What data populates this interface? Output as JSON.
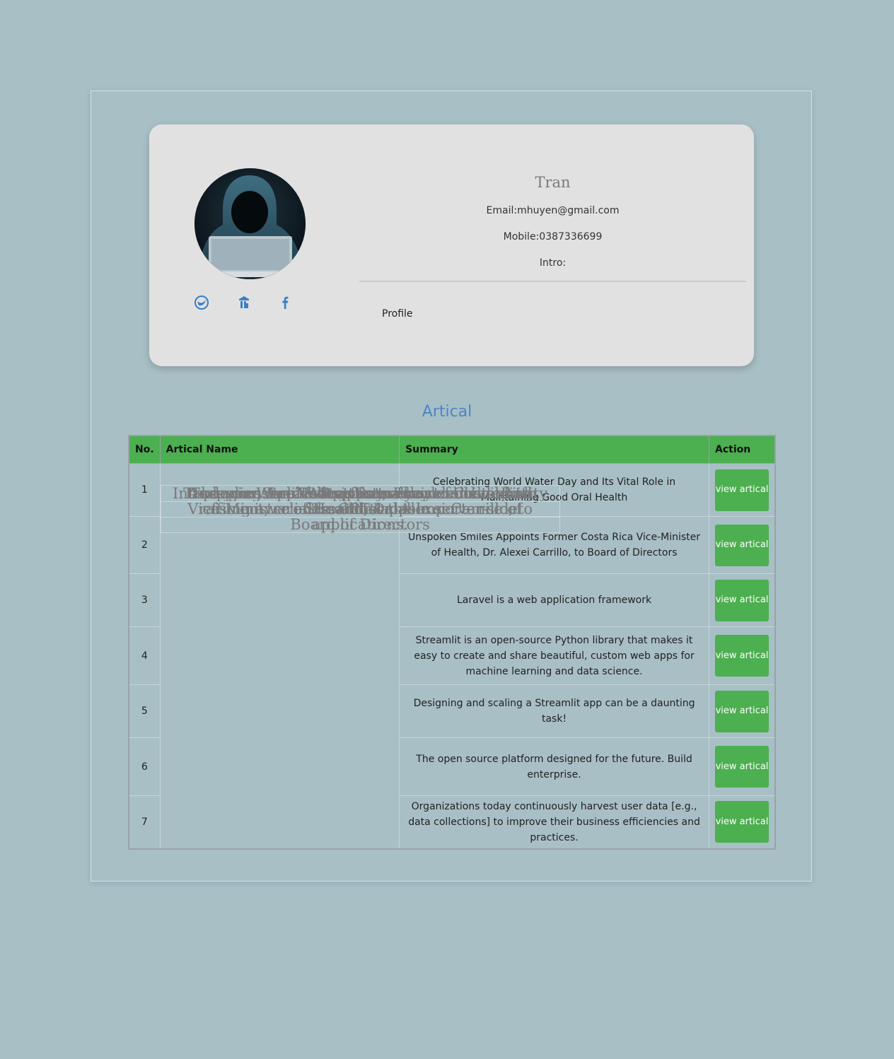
{
  "profile": {
    "name": "Tran",
    "email_label": "Email:mhuyen@gmail.com",
    "mobile_label": "Mobile:0387336699",
    "intro_label": "Intro:",
    "profile_link": "Profile",
    "social_icons": [
      "twitter-icon",
      "linkedin-icon",
      "facebook-icon"
    ],
    "accent_color": "#3b7fc4"
  },
  "articles": {
    "title": "Artical",
    "headers": [
      "No.",
      "Artical Name",
      "Summary",
      "Action"
    ],
    "button_label": "view artical",
    "rows": [
      {
        "no": "1",
        "name": "Today is World Water Day, a day dedicated to raising awareness about the importance of",
        "summary": "Celebrating World Water Day and Its Vital Role in Maintaining Good Oral Health"
      },
      {
        "no": "2",
        "name": "Unspoken Smiles Appoints Former Costa Rica Vice-Minister of Health, Dr. Alexei Carrillo, to Board of Directors",
        "summary": "Unspoken Smiles Appoints Former Costa Rica Vice-Minister of Health, Dr. Alexei Carrillo, to Board of Directors"
      },
      {
        "no": "3",
        "name": "Meet Laravel",
        "summary": "Laravel is a web application framework"
      },
      {
        "no": "4",
        "name": "Introducing AppTest: a faster way to build quality Streamlit apps",
        "summary": "Streamlit is an open-source Python library that makes it easy to create and share beautiful, custom web apps for machine learning and data science."
      },
      {
        "no": "5",
        "name": "Take your Streamlit apps to the next level with GPT-4",
        "summary": "Designing and scaling a Streamlit app can be a daunting task!"
      },
      {
        "no": "6",
        "name": "A progressive Node.js framework for building efficient, reliable and scalable server-side applications.",
        "summary": "The open source platform designed for the future. Build enterprise."
      },
      {
        "no": "7",
        "name": "a thematic analysis",
        "summary": "Organizations today continuously harvest user data [e.g., data collections] to improve their business efficiencies and practices."
      }
    ]
  },
  "colors": {
    "background": "#a8bfc6",
    "card": "#e1e1e1",
    "header_green": "#4caf50",
    "title_blue": "#4a86c8"
  }
}
